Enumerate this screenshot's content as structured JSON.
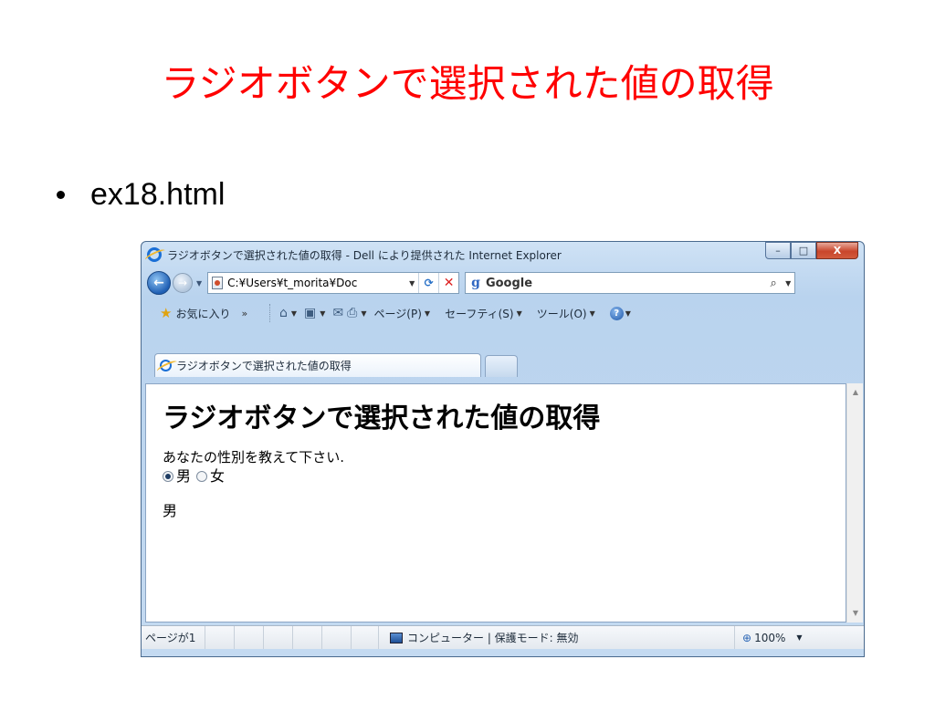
{
  "slide": {
    "title": "ラジオボタンで選択された値の取得",
    "bullet": "ex18.html"
  },
  "window": {
    "title": "ラジオボタンで選択された値の取得 - Dell により提供された Internet Explorer",
    "min_label": "–",
    "max_label": "□",
    "close_label": "X"
  },
  "nav": {
    "back_label": "←",
    "forward_label": "→",
    "address": "C:¥Users¥t_morita¥Doc",
    "search_placeholder": "Google",
    "search_brand": "g"
  },
  "commands": {
    "favorites": "お気に入り",
    "page": "ページ(P)",
    "safety": "セーフティ(S)",
    "tools": "ツール(O)"
  },
  "tab": {
    "label": "ラジオボタンで選択された値の取得"
  },
  "page": {
    "heading": "ラジオボタンで選択された値の取得",
    "question": "あなたの性別を教えて下さい.",
    "options": [
      {
        "label": "男",
        "checked": true
      },
      {
        "label": "女",
        "checked": false
      }
    ],
    "result": "男"
  },
  "status": {
    "text": "ページが1",
    "zone": "コンピューター | 保護モード: 無効",
    "zoom": "100%"
  },
  "colors": {
    "slide_title": "#ff0000"
  }
}
